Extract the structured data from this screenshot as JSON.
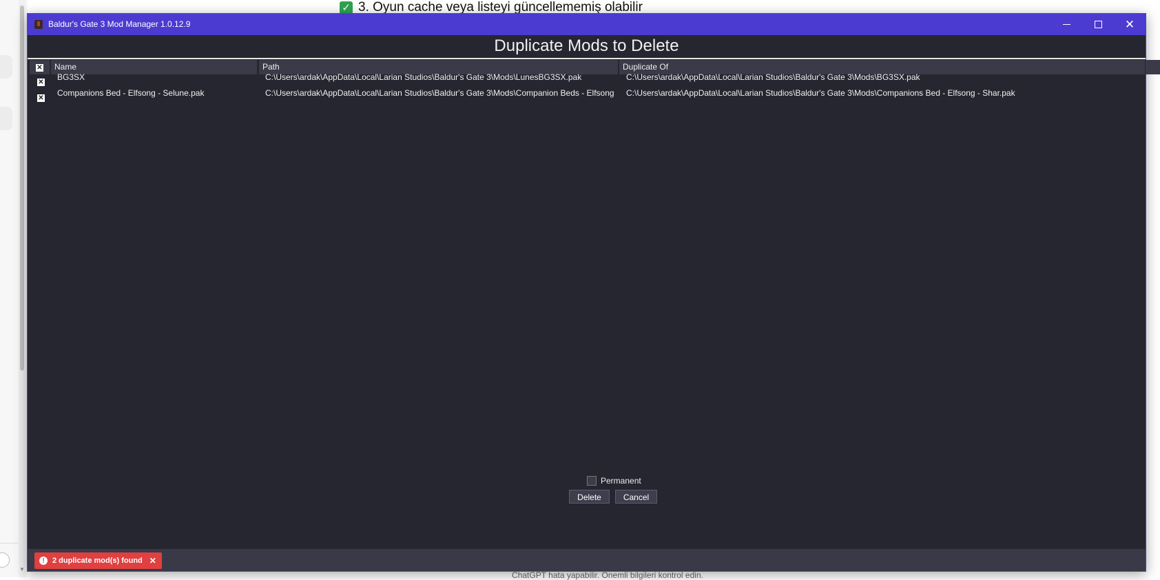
{
  "background": {
    "heading": "3. Oyun cache veya listeyi güncellememiş olabilir",
    "footer": "ChatGPT hata yapabilir. Önemli bilgileri kontrol edin."
  },
  "window": {
    "title": "Baldur's Gate 3 Mod Manager 1.0.12.9"
  },
  "dialog": {
    "title": "Duplicate Mods to Delete",
    "columns": {
      "check": "✕",
      "name": "Name",
      "path": "Path",
      "duplicate_of": "Duplicate Of"
    },
    "rows": [
      {
        "checked": true,
        "check_glyph": "✕",
        "name": "BG3SX",
        "path": "C:\\Users\\ardak\\AppData\\Local\\Larian Studios\\Baldur's Gate 3\\Mods\\LunesBG3SX.pak",
        "duplicate_of": "C:\\Users\\ardak\\AppData\\Local\\Larian Studios\\Baldur's Gate 3\\Mods\\BG3SX.pak"
      },
      {
        "checked": true,
        "check_glyph": "✕",
        "name": "Companions Bed - Elfsong - Selune.pak",
        "path": "C:\\Users\\ardak\\AppData\\Local\\Larian Studios\\Baldur's Gate 3\\Mods\\Companion Beds - Elfsong",
        "duplicate_of": "C:\\Users\\ardak\\AppData\\Local\\Larian Studios\\Baldur's Gate 3\\Mods\\Companions Bed - Elfsong - Shar.pak"
      }
    ],
    "permanent_label": "Permanent",
    "permanent_checked": false,
    "delete_label": "Delete",
    "cancel_label": "Cancel"
  },
  "status": {
    "message": "2 duplicate mod(s) found",
    "error_glyph": "!",
    "close_glyph": "✕"
  }
}
